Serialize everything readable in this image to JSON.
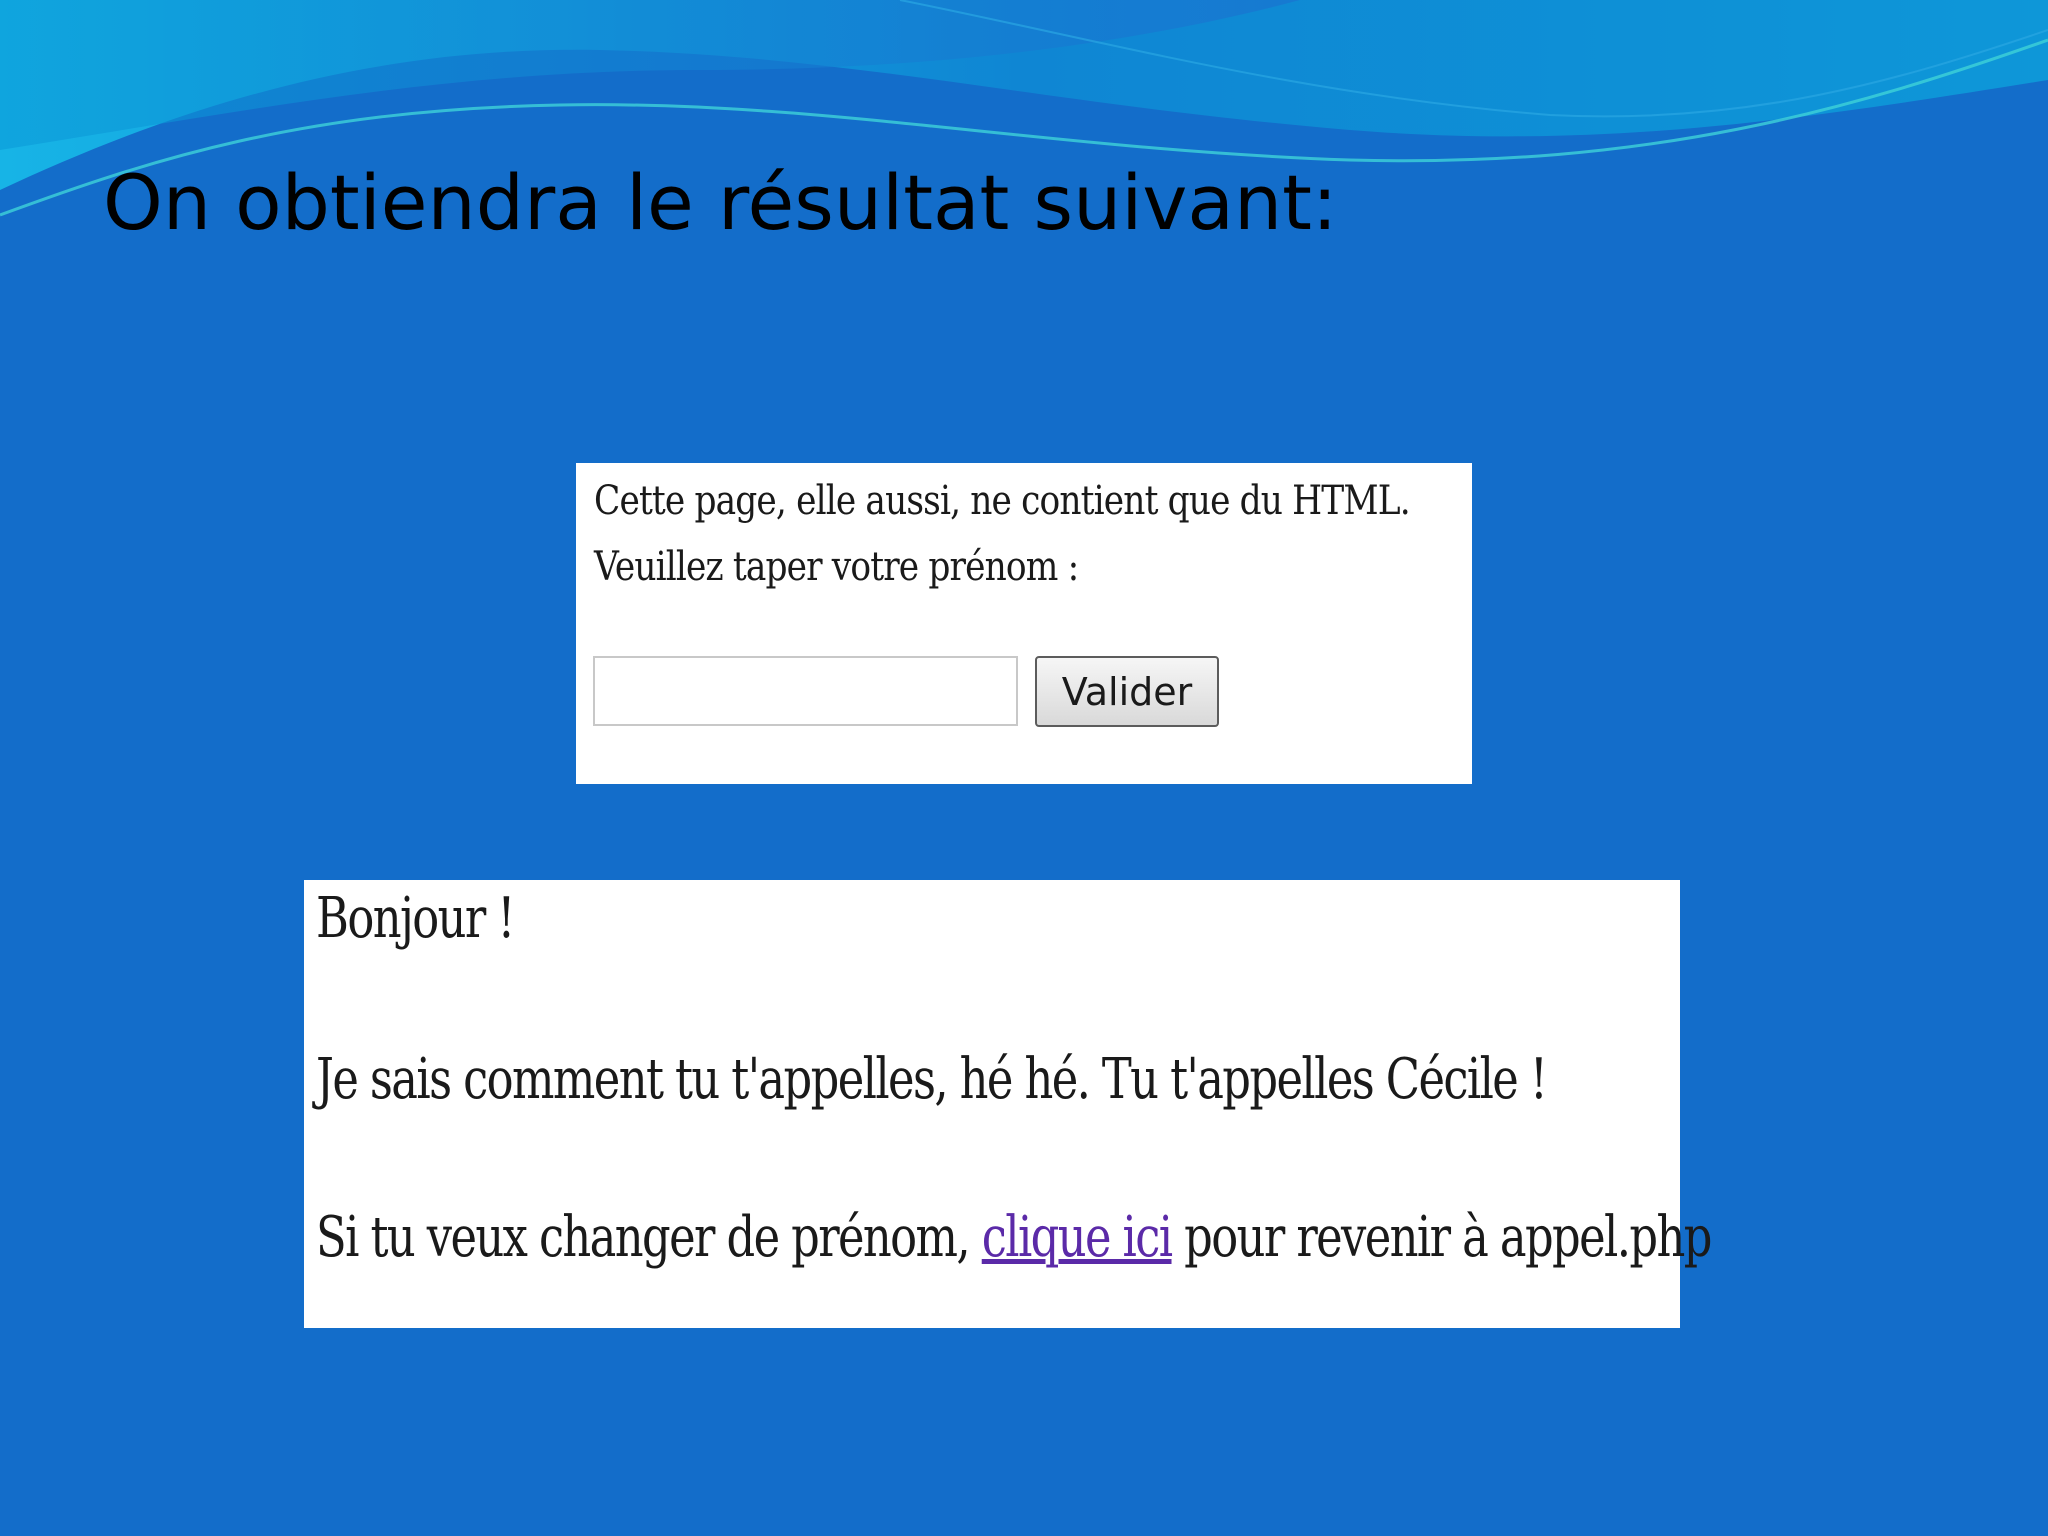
{
  "slide": {
    "title": "On obtiendra le résultat suivant:",
    "background_color": "#136dca",
    "text_color": "#000000"
  },
  "form_page": {
    "line1": "Cette page, elle aussi, ne contient que du HTML.",
    "line2": "Veuillez taper votre prénom :",
    "input_value": "",
    "button_label": "Valider"
  },
  "result_page": {
    "greeting": "Bonjour !",
    "message": "Je sais comment tu t'appelles, hé hé. Tu t'appelles Cécile !",
    "change_prefix": "Si tu veux changer de prénom,",
    "link_text": "clique ici",
    "change_suffix": "pour revenir à appel.php",
    "link_color": "#5b2aa8"
  }
}
